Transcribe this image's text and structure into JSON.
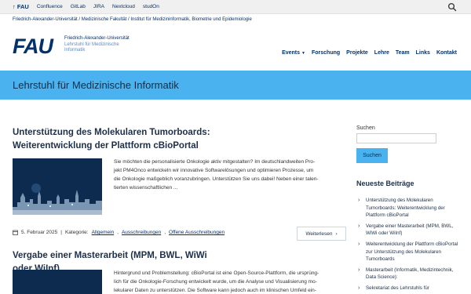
{
  "topbar": {
    "links": [
      "↑ FAU",
      "Confluence",
      "GitLab",
      "JIRA",
      "Nextcloud",
      "studOn"
    ],
    "search_icon": "search-icon"
  },
  "breadcrumb": "Friedrich-Alexander-Universität / Medizinische Fakultät / Institut für Medizininformatik, Biometrie und Epidemiologie",
  "logo": {
    "mark": "FAU",
    "line1": "Friedrich-Alexander-Universität",
    "line2": "Lehrstuhl für Medizinische",
    "line3": "Informatik"
  },
  "nav": {
    "items": [
      "Events",
      "Forschung",
      "Projekte",
      "Lehre",
      "Team",
      "Links",
      "Kontakt"
    ]
  },
  "banner": {
    "title": "Lehrstuhl für Medizinische Informatik"
  },
  "posts": [
    {
      "title_line1": "Unterstützung des Molekularen Tumorboards:",
      "title_line2": "Weiterentwicklung der Plattform cBioPortal",
      "excerpt_lines": [
        "Sie möchten die personalisierte Onkologie aktiv mitgestalten? Im deutschlandweiten Pro-",
        "jekt PM4Onco entwickeln wir innovative Softwarelösungen und optimieren Prozesse, um",
        "die Onkologie maßgeblich voranzubringen. Unterstützen Sie uns dabei!   Neben einer talen-",
        "tierten wissenschaftlichen ..."
      ],
      "date": "5. Februar 2025",
      "category_label": "Kategorie:",
      "categories": [
        "Allgemein",
        "Ausschreibungen",
        "Offene Ausschreibungen"
      ],
      "read_more": "Weiterlesen"
    },
    {
      "title_line1": "Vergabe einer Masterarbeit (MPM, BWL, WiWi oder WiInf)",
      "excerpt_lines": [
        "Hintergrund und Problemstellung: cBioPortal ist eine Open-Source-Plattform, die ursprüng-",
        "lich für die Onkologie-Forschung entwickelt wurde, um die Analyse und Visualisierung mo-",
        "lekularer Daten zu unterstützen. Die Software kann jedoch auch im klinischen Umfeld ein-"
      ]
    }
  ],
  "sidebar": {
    "search_label": "Suchen",
    "search_placeholder": "",
    "search_button": "Suchen",
    "recent_heading": "Neueste Beiträge",
    "recent": [
      "Unterstützung des Molekularen Tumorboards: Weiterentwicklung der Plattform cBioPortal",
      "Vergabe einer Masterarbeit (MPM, BWL, WiWi oder WiInf)",
      "Weiterentwicklung der Plattform cBioPortal zur Unterstützung des Molekularen Tumorboards",
      "Masterarbeit (Informatik, Medizintechnik, Data Science):",
      "Sekretariat des Lehrstuhls für"
    ]
  },
  "colors": {
    "brand": "#04316a",
    "accent": "#4ab3ef",
    "thumb_bg": "#0d2b4e"
  }
}
